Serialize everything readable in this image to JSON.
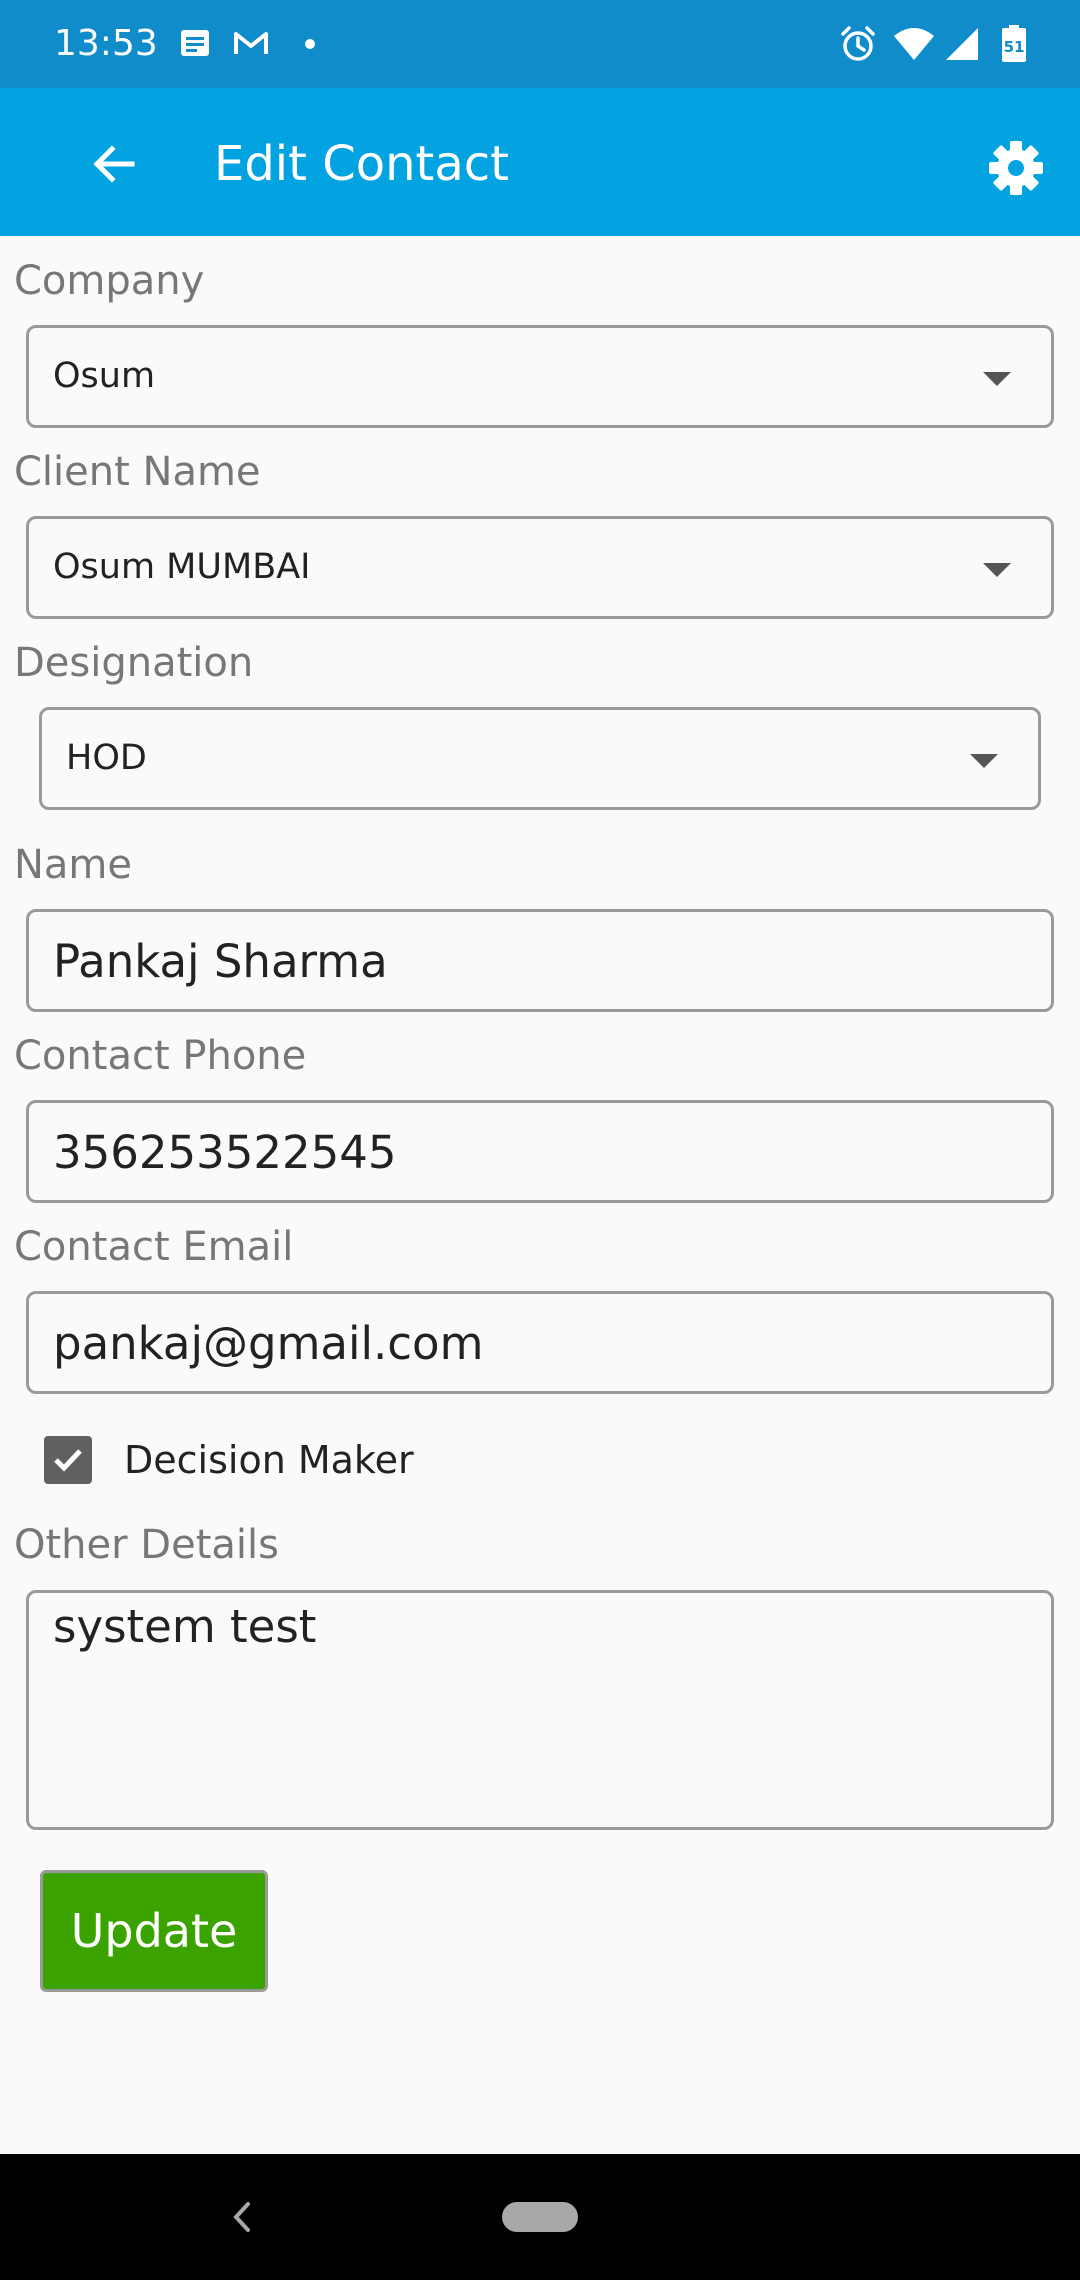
{
  "status_bar": {
    "time": "13:53",
    "battery_level": "51",
    "left_icons": [
      "message-icon",
      "gmail-icon",
      "dot-icon"
    ],
    "right_icons": [
      "alarm-icon",
      "wifi-icon",
      "signal-icon",
      "battery-icon"
    ]
  },
  "app_bar": {
    "title": "Edit Contact",
    "back_icon": "arrow-left-icon",
    "settings_icon": "gear-icon"
  },
  "form": {
    "company": {
      "label": "Company",
      "value": "Osum"
    },
    "client_name": {
      "label": "Client Name",
      "value": "Osum MUMBAI"
    },
    "designation": {
      "label": "Designation",
      "value": "HOD"
    },
    "name": {
      "label": "Name",
      "value": "Pankaj Sharma"
    },
    "contact_phone": {
      "label": "Contact Phone",
      "value": "356253522545"
    },
    "contact_email": {
      "label": "Contact Email",
      "value": "pankaj@gmail.com"
    },
    "decision_maker": {
      "label": "Decision Maker",
      "checked": true
    },
    "other_details": {
      "label": "Other Details",
      "value": "system test"
    },
    "update_label": "Update"
  },
  "colors": {
    "status_bar": "#0f8cc9",
    "app_bar": "#03a3e2",
    "update_button": "#3aa300",
    "checkbox": "#606060"
  }
}
